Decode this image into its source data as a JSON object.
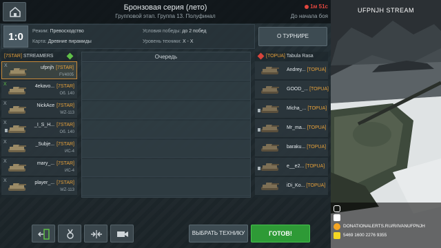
{
  "header": {
    "title": "Бронзовая серия (лето)",
    "subtitle": "Групповой этап. Группа 13. Полуфинал",
    "timer": "1м 51с",
    "timer_label": "До начала боя"
  },
  "info": {
    "score": "1:0",
    "mode_label": "Режим:",
    "mode_value": "Превосходство",
    "map_label": "Карта:",
    "map_value": "Древние пирамиды",
    "win_label": "Условия победы:",
    "win_value": "до 2 побед",
    "tier_label": "Уровень техники:",
    "tier_value": "X - X",
    "about_button": "О ТУРНИРЕ"
  },
  "team_left": {
    "tag": "[7STAR]",
    "name": "STREAMERS",
    "color": "#5fbf48",
    "players": [
      {
        "x": "X",
        "name": "ufpnjh",
        "tag": "[7STAR]",
        "vehicle": "FV4005",
        "selected": true
      },
      {
        "x": "X",
        "name": "4ekavo...",
        "tag": "[7STAR]",
        "vehicle": "Об. 140",
        "selected": false
      },
      {
        "x": "X",
        "name": "NickAce",
        "tag": "[7STAR]",
        "vehicle": "WZ-113",
        "selected": false
      },
      {
        "x": "X",
        "name": "_I_S_H...",
        "tag": "[7STAR]",
        "vehicle": "Об. 140",
        "selected": false
      },
      {
        "x": "X",
        "name": "_Subje...",
        "tag": "[7STAR]",
        "vehicle": "ИС-4",
        "selected": false
      },
      {
        "x": "X",
        "name": "mary_...",
        "tag": "[7STAR]",
        "vehicle": "ИС-4",
        "selected": false
      },
      {
        "x": "X",
        "name": "player_...",
        "tag": "[7STAR]",
        "vehicle": "WZ-113",
        "selected": false
      }
    ]
  },
  "team_right": {
    "tag": "[TOPUA]",
    "name": "Tabula Rasa",
    "color": "#d8443c",
    "players": [
      {
        "name": "Andrey...",
        "tag": "[TOPUA]"
      },
      {
        "name": "GOOD_...",
        "tag": "[TOPUA]"
      },
      {
        "name": "Micha_...",
        "tag": "[TOPUA]"
      },
      {
        "name": "Mr_ma...",
        "tag": "[TOPUA]"
      },
      {
        "name": "baraku...",
        "tag": "[TOPUA]"
      },
      {
        "name": "e__e2...",
        "tag": "[TOPUA]"
      },
      {
        "name": "iDi_Ko...",
        "tag": "[TOPUA]"
      }
    ]
  },
  "queue": {
    "title": "Очередь"
  },
  "toolbar": {
    "exit_icon": "exit-door-icon",
    "medal_icon": "medal-icon",
    "compare_icon": "compare-icon",
    "camera_icon": "camera-icon",
    "choose_button": "ВЫБРАТЬ ТЕХНИКУ",
    "ready_button": "ГОТОВ!"
  },
  "stream": {
    "title": "UFPNJH STREAM",
    "social": [
      {
        "icon": "instagram-icon",
        "text": ""
      },
      {
        "icon": "vk-icon",
        "text": ""
      },
      {
        "icon": "donationalerts-icon",
        "text": "DONATIONALERTS.RU/R/IVANUFPNJH"
      },
      {
        "icon": "card-icon",
        "text": "5469 1600 2276 9355"
      }
    ]
  }
}
